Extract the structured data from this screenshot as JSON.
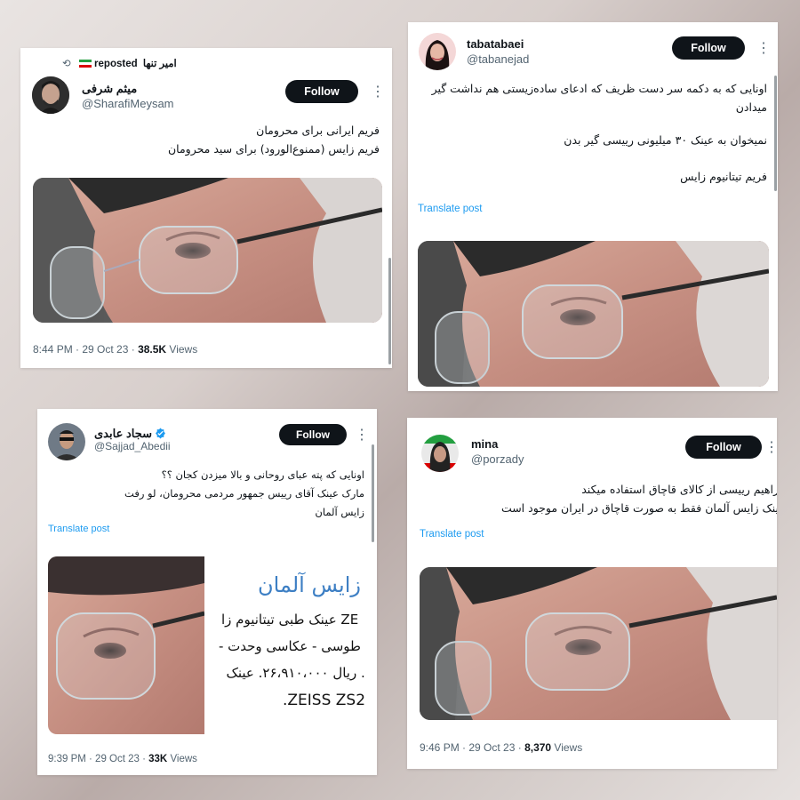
{
  "colors": {
    "accent": "#1d9bf0",
    "text": "#0f1419",
    "muted": "#536471",
    "button": "#0f1419"
  },
  "tweets": [
    {
      "repost_user": "امیر تنها",
      "repost_label": "reposted",
      "name": "میثم شرفی",
      "handle": "@SharafiMeysam",
      "follow": "Follow",
      "more_icon": "⋮",
      "lines": [
        "فریم ایرانی برای محرومان",
        "فریم زایس (ممنوع‌الورود) برای سید محرومان"
      ],
      "time": "8:44 PM · 29 Oct 23 · ",
      "views_count": "38.5K",
      "views_label": " Views"
    },
    {
      "name": "tabatabaei",
      "handle": "@tabanejad",
      "follow": "Follow",
      "more_icon": "⋮",
      "lines": [
        "اونایی که به دکمه سر دست ظریف که ادعای ساده‌زیستی هم نداشت گیر میدادن",
        "نمیخوان به عینک ۳۰ میلیونی رییسی گیر بدن",
        "فریم تیتانیوم زایس"
      ],
      "translate": "Translate post"
    },
    {
      "name": "سجاد عابدی",
      "handle": "@Sajjad_Abedii",
      "follow": "Follow",
      "more_icon": "⋮",
      "lines": [
        "اونایی که پته عبای روحانی و بالا میزدن کجان ؟؟",
        "مارک عینک آقای رییس جمهور مردمی محرومان، لو رفت",
        "زایس آلمان"
      ],
      "translate": "Translate post",
      "ad_title": "زایس آلمان",
      "ad_lines": [
        "ZE ۰ عینک طبی تیتانیوم زا",
        "طوسی - عکاسی وحدت -",
        "ز. ریال ۲۶،۹۱۰،۰۰۰. عینک",
        ".ZEISS ZS2"
      ],
      "time": "9:39 PM · 29 Oct 23 · ",
      "views_count": "33K",
      "views_label": " Views"
    },
    {
      "name": "mina",
      "handle": "@porzady",
      "follow": "Follow",
      "more_icon": "⋮",
      "lines": [
        "راهیم رییسی از کالای قاچاق استفاده میکند",
        "ینک زایس آلمان فقط به صورت قاچاق در ایران موجود است"
      ],
      "translate": "Translate post",
      "time": "9:46 PM · 29 Oct 23 · ",
      "views_count": "8,370",
      "views_label": " Views"
    }
  ]
}
